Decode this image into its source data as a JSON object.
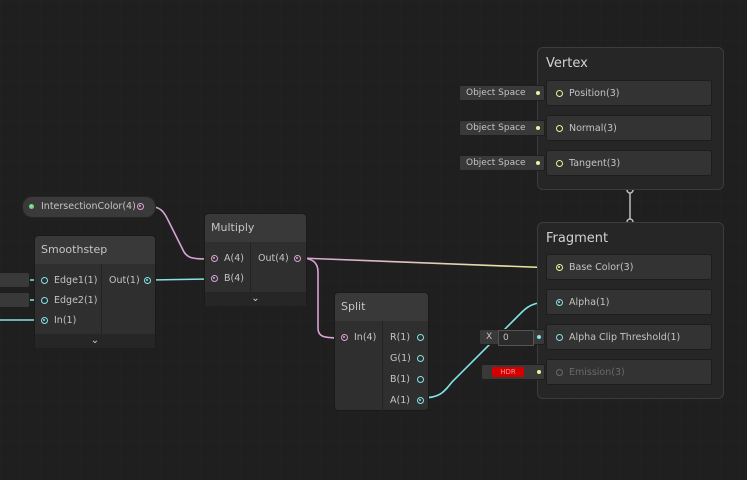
{
  "nodes": {
    "intersection_property": {
      "label": "IntersectionColor(4)"
    },
    "smoothstep": {
      "title": "Smoothstep",
      "inputs": [
        "Edge1(1)",
        "Edge2(1)",
        "In(1)"
      ],
      "output": "Out(1)"
    },
    "multiply": {
      "title": "Multiply",
      "inputs": [
        "A(4)",
        "B(4)"
      ],
      "output": "Out(4)"
    },
    "split": {
      "title": "Split",
      "input": "In(4)",
      "outputs": [
        "R(1)",
        "G(1)",
        "B(1)",
        "A(1)"
      ]
    }
  },
  "vertex": {
    "title": "Vertex",
    "blocks": [
      {
        "label": "Position(3)",
        "input": "Object Space"
      },
      {
        "label": "Normal(3)",
        "input": "Object Space"
      },
      {
        "label": "Tangent(3)",
        "input": "Object Space"
      }
    ]
  },
  "fragment": {
    "title": "Fragment",
    "blocks": [
      {
        "label": "Base Color(3)"
      },
      {
        "label": "Alpha(1)"
      },
      {
        "label": "Alpha Clip Threshold(1)",
        "x_label": "X",
        "x_value": "0"
      },
      {
        "label": "Emission(3)",
        "swatch": "HDR"
      }
    ]
  },
  "colors": {
    "background": "#1f1f1f",
    "wire_vector4": "#d8a3d6",
    "wire_float": "#84e4e7",
    "wire_vector3": "#f0f09b",
    "hdr_swatch": "#d40000"
  }
}
